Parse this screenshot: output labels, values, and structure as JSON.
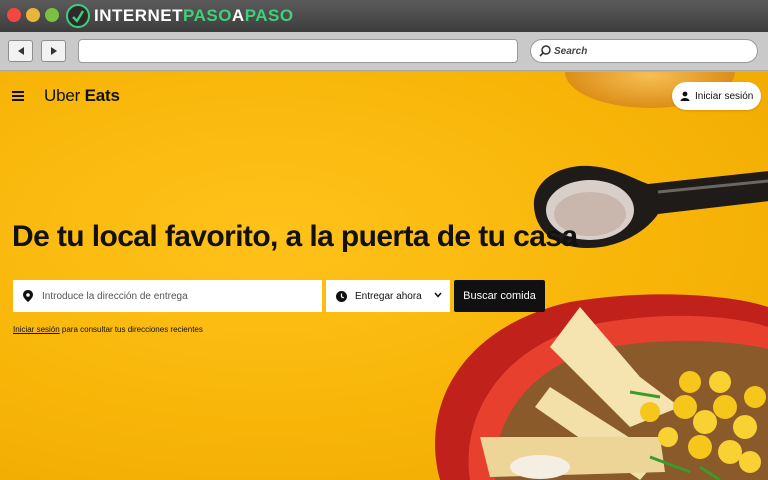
{
  "window": {
    "brand_prefix": "INTERNET",
    "brand_accent": "PASO",
    "brand_mid": "A",
    "brand_suffix": "PASO",
    "search_placeholder": "Search",
    "url": ""
  },
  "colors": {
    "page_background": "#f6b400",
    "button_dark": "#111111",
    "brand_green": "#3fd07a"
  },
  "icons": {
    "back": "arrow-left-icon",
    "forward": "arrow-right-icon",
    "search": "magnifier-icon",
    "menu": "hamburger-icon",
    "user": "person-icon",
    "location": "map-pin-icon",
    "clock": "clock-icon",
    "chevron": "chevron-down-icon"
  },
  "header": {
    "logo_light": "Uber",
    "logo_bold": "Eats",
    "signin_label": "Iniciar sesión"
  },
  "hero": {
    "headline": "De tu local favorito, a la puerta de tu casa",
    "address_placeholder": "Introduce la dirección de entrega",
    "time_label": "Entregar ahora",
    "search_button": "Buscar comida",
    "recent_link": "Iniciar sesión",
    "recent_text": " para consultar tus direcciones recientes"
  }
}
